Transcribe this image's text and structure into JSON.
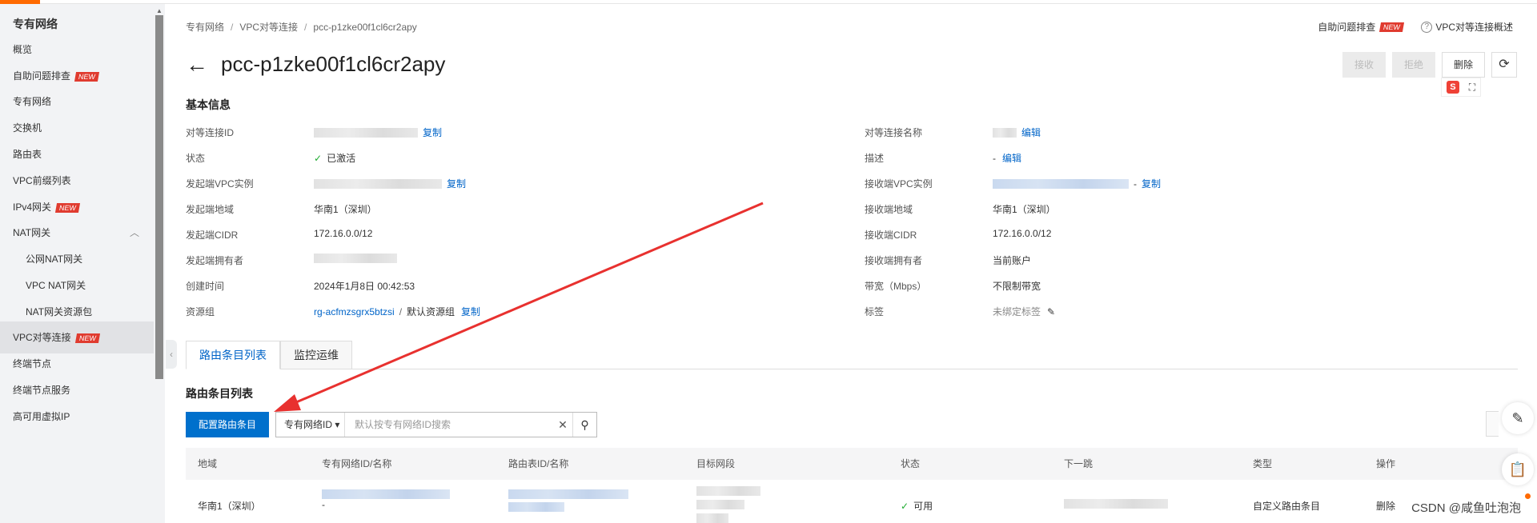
{
  "sidebar": {
    "title": "专有网络",
    "items": [
      {
        "label": "概览",
        "badge": ""
      },
      {
        "label": "自助问题排查",
        "badge": "NEW"
      },
      {
        "label": "专有网络",
        "badge": ""
      },
      {
        "label": "交换机",
        "badge": ""
      },
      {
        "label": "路由表",
        "badge": ""
      },
      {
        "label": "VPC前缀列表",
        "badge": ""
      },
      {
        "label": "IPv4网关",
        "badge": "NEW"
      },
      {
        "label": "NAT网关",
        "badge": ""
      },
      {
        "label": "公网NAT网关",
        "badge": ""
      },
      {
        "label": "VPC NAT网关",
        "badge": ""
      },
      {
        "label": "NAT网关资源包",
        "badge": ""
      },
      {
        "label": "VPC对等连接",
        "badge": "NEW"
      },
      {
        "label": "终端节点",
        "badge": ""
      },
      {
        "label": "终端节点服务",
        "badge": ""
      },
      {
        "label": "高可用虚拟IP",
        "badge": ""
      }
    ]
  },
  "breadcrumb": [
    "专有网络",
    "VPC对等连接",
    "pcc-p1zke00f1cl6cr2apy"
  ],
  "top_links": {
    "troubleshoot": "自助问题排查",
    "troubleshoot_badge": "NEW",
    "overview": "VPC对等连接概述"
  },
  "page": {
    "title": "pcc-p1zke00f1cl6cr2apy"
  },
  "actions": {
    "accept": "接收",
    "reject": "拒绝",
    "delete": "删除"
  },
  "basic_info": {
    "title": "基本信息",
    "left": [
      {
        "label": "对等连接ID",
        "value": "",
        "action": "复制"
      },
      {
        "label": "状态",
        "value": "已激活"
      },
      {
        "label": "发起端VPC实例",
        "value": "",
        "action": "复制"
      },
      {
        "label": "发起端地域",
        "value": "华南1（深圳）"
      },
      {
        "label": "发起端CIDR",
        "value": "172.16.0.0/12"
      },
      {
        "label": "发起端拥有者",
        "value": ""
      },
      {
        "label": "创建时间",
        "value": "2024年1月8日 00:42:53"
      },
      {
        "label": "资源组",
        "value": "rg-acfmzsgrx5btzsi",
        "extra": "默认资源组",
        "action": "复制"
      }
    ],
    "right": [
      {
        "label": "对等连接名称",
        "value": "",
        "action": "编辑"
      },
      {
        "label": "描述",
        "value": "-",
        "action": "编辑"
      },
      {
        "label": "接收端VPC实例",
        "value": "-",
        "action": "复制"
      },
      {
        "label": "接收端地域",
        "value": "华南1（深圳）"
      },
      {
        "label": "接收端CIDR",
        "value": "172.16.0.0/12"
      },
      {
        "label": "接收端拥有者",
        "value": "当前账户"
      },
      {
        "label": "带宽（Mbps）",
        "value": "不限制带宽"
      },
      {
        "label": "标签",
        "value": "未绑定标签"
      }
    ]
  },
  "tabs": [
    "路由条目列表",
    "监控运维"
  ],
  "route_list": {
    "title": "路由条目列表",
    "config_button": "配置路由条目",
    "search_select": "专有网络ID",
    "search_placeholder": "默认按专有网络ID搜索",
    "columns": [
      "地域",
      "专有网络ID/名称",
      "路由表ID/名称",
      "目标网段",
      "状态",
      "下一跳",
      "类型",
      "操作"
    ],
    "rows": [
      {
        "region": "华南1（深圳）",
        "vpc_sub": "-",
        "status": "可用",
        "type": "自定义路由条目",
        "op": "删除"
      }
    ]
  },
  "watermark": "CSDN @咸鱼吐泡泡",
  "colors": {
    "accent": "#0070cc",
    "link": "#0064c8",
    "annotation_arrow": "#e8312f",
    "brand_orange": "#ff6a00"
  }
}
